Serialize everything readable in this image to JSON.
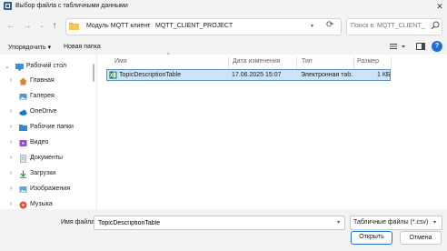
{
  "window": {
    "title": "Выбор файла с табличными данными",
    "close_glyph": "✕"
  },
  "address_bar": {
    "breadcrumbs": [
      "Модуль MQTT клиент",
      "MQTT_CLIENT_PROJECT"
    ],
    "separator": "›"
  },
  "search": {
    "placeholder": "Поиск в: MQTT_CLIENT_PR..."
  },
  "toolbar": {
    "organize_label": "Упорядочить ▾",
    "new_folder_label": "Новая папка"
  },
  "sidebar": {
    "items": [
      {
        "label": "Рабочий стол",
        "icon": "desktop-icon",
        "expanded": true
      },
      {
        "label": "Главная",
        "icon": "home-icon"
      },
      {
        "label": "Галерея",
        "icon": "gallery-icon"
      },
      {
        "label": "OneDrive",
        "icon": "onedrive-icon"
      },
      {
        "label": "Рабочие папки",
        "icon": "work-folders-icon"
      },
      {
        "label": "Видео",
        "icon": "video-icon"
      },
      {
        "label": "Документы",
        "icon": "documents-icon"
      },
      {
        "label": "Загрузки",
        "icon": "downloads-icon"
      },
      {
        "label": "Изображения",
        "icon": "pictures-icon"
      },
      {
        "label": "Музыка",
        "icon": "music-icon"
      }
    ]
  },
  "file_list": {
    "columns": [
      "Имя",
      "Дата изменения",
      "Тип",
      "Размер"
    ],
    "rows": [
      {
        "name": "TopicDescriptionTable",
        "date": "17.06.2025 15:07",
        "type": "Электронная таб...",
        "size": "1 КБ",
        "selected": true
      }
    ]
  },
  "footer": {
    "filename_label": "Имя файла:",
    "filename_value": "TopicDescriptionTable",
    "filter_value": "Табличные файлы (*.csv)",
    "open_label": "Открыть",
    "cancel_label": "Отмена"
  },
  "colors": {
    "accent": "#1f6fd0",
    "selection_bg": "#cfe3f7",
    "selection_border": "#5d8fc9"
  }
}
